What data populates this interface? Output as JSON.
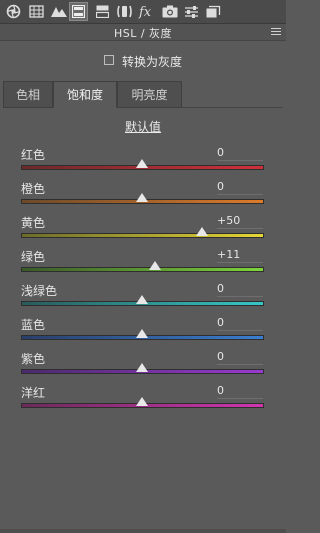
{
  "toolbar": {
    "icons": [
      "aperture-icon",
      "histogram-icon",
      "mountains-icon",
      "hsl-icon",
      "split-toning-icon",
      "lens-icon",
      "fx-icon",
      "camera-icon",
      "sliders-icon",
      "presets-icon"
    ],
    "active": "hsl-icon"
  },
  "header": {
    "title": "HSL / 灰度"
  },
  "grayscale": {
    "label": "转换为灰度",
    "checked": false
  },
  "tabs": [
    {
      "label": "色相",
      "active": false
    },
    {
      "label": "饱和度",
      "active": true
    },
    {
      "label": "明亮度",
      "active": false
    }
  ],
  "default_label": "默认值",
  "sliders": [
    {
      "label": "红色",
      "value": "0",
      "level": 0,
      "gradient": [
        "#6b2a2a",
        "#d0303a"
      ]
    },
    {
      "label": "橙色",
      "value": "0",
      "level": 0,
      "gradient": [
        "#6b4a2a",
        "#dd7a2a"
      ]
    },
    {
      "label": "黄色",
      "value": "+50",
      "level": 50,
      "gradient": [
        "#6b6b2a",
        "#e6d636"
      ]
    },
    {
      "label": "绿色",
      "value": "+11",
      "level": 11,
      "gradient": [
        "#3a5a2a",
        "#7ed43a"
      ]
    },
    {
      "label": "浅绿色",
      "value": "0",
      "level": 0,
      "gradient": [
        "#2a5a5a",
        "#36c7c7"
      ]
    },
    {
      "label": "蓝色",
      "value": "0",
      "level": 0,
      "gradient": [
        "#2a3f6b",
        "#3a7ed0"
      ]
    },
    {
      "label": "紫色",
      "value": "0",
      "level": 0,
      "gradient": [
        "#4a2a6b",
        "#9a3ad0"
      ]
    },
    {
      "label": "洋红",
      "value": "0",
      "level": 0,
      "gradient": [
        "#6b2a5a",
        "#d036b0"
      ]
    }
  ]
}
